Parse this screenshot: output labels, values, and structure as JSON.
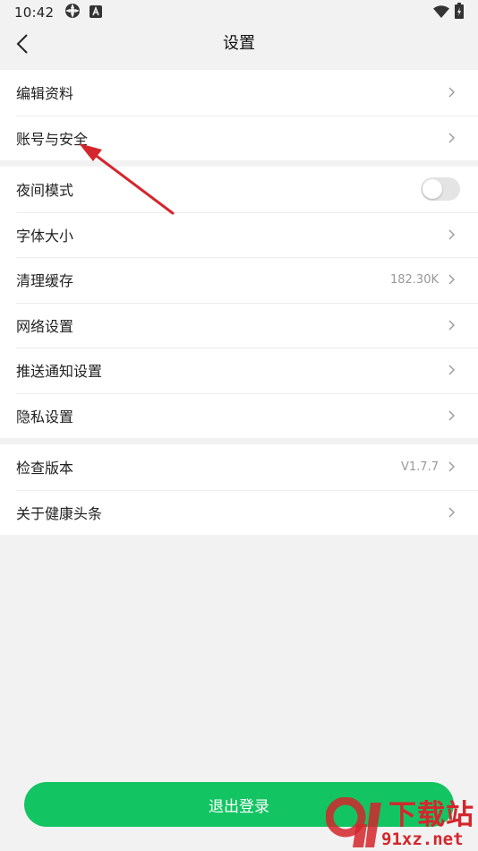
{
  "status_bar": {
    "time": "10:42"
  },
  "header": {
    "title": "设置"
  },
  "groups": [
    {
      "items": [
        {
          "label": "编辑资料"
        },
        {
          "label": "账号与安全"
        }
      ]
    },
    {
      "items": [
        {
          "label": "夜间模式",
          "toggle": false
        },
        {
          "label": "字体大小"
        },
        {
          "label": "清理缓存",
          "value": "182.30K"
        },
        {
          "label": "网络设置"
        },
        {
          "label": "推送通知设置"
        },
        {
          "label": "隐私设置"
        }
      ]
    },
    {
      "items": [
        {
          "label": "检查版本",
          "value": "V1.7.7"
        },
        {
          "label": "关于健康头条"
        }
      ]
    }
  ],
  "logout": {
    "label": "退出登录"
  },
  "watermark": {
    "brand": "下载站",
    "domain": "91xz.net"
  },
  "colors": {
    "accent": "#13c463",
    "annotation": "#d4262c",
    "watermark": "#d4262c"
  }
}
